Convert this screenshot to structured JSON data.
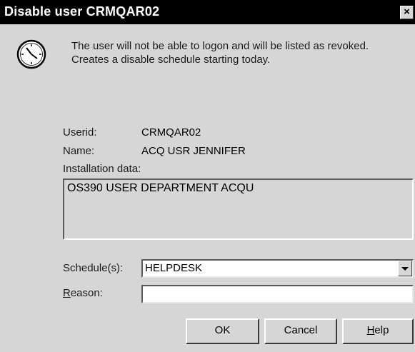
{
  "window": {
    "title": "Disable user CRMQAR02",
    "close_glyph": "×"
  },
  "icon": "clock-icon",
  "message": {
    "line1": "The user will not be able to logon and will be listed as revoked.",
    "line2": "Creates a disable schedule starting today."
  },
  "fields": {
    "userid_label": "Userid:",
    "userid_value": "CRMQAR02",
    "name_label": "Name:",
    "name_value": "ACQ USR JENNIFER",
    "installation_label": "Installation data:",
    "installation_value": "OS390 USER DEPARTMENT ACQU"
  },
  "schedule": {
    "label": "Schedule(s):",
    "selected": "HELPDESK"
  },
  "reason": {
    "label_mnemonic": "R",
    "label_rest": "eason:",
    "value": ""
  },
  "buttons": {
    "ok": "OK",
    "cancel": "Cancel",
    "help_mnemonic": "H",
    "help_rest": "elp"
  },
  "colors": {
    "dialog_bg": "#d6d6d6",
    "titlebar_bg": "#000000",
    "titlebar_text": "#ffffff"
  }
}
